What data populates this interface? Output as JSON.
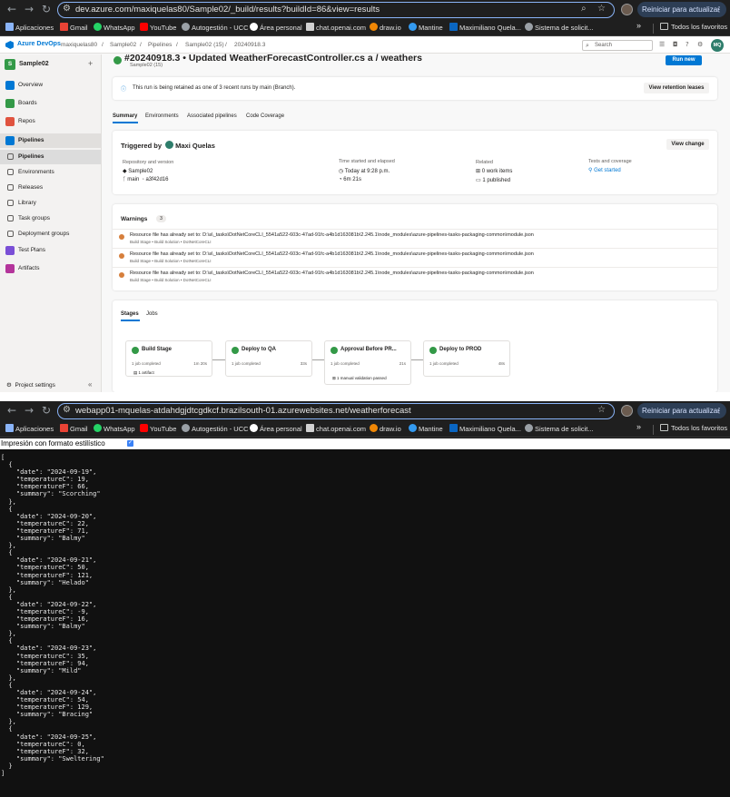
{
  "browser_top": {
    "url": "dev.azure.com/maxiquelas80/Sample02/_build/results?buildId=86&view=results",
    "restart_label": "Reiniciar para actualizar",
    "bookmarks": [
      "Aplicaciones",
      "Gmail",
      "WhatsApp",
      "YouTube",
      "Autogestión - UCC",
      "Área personal",
      "chat.openai.com",
      "draw.io",
      "Mantine",
      "Maximiliano Quela...",
      "Sistema de solicit..."
    ],
    "all_bookmarks": "Todos los favoritos"
  },
  "ado": {
    "brand": "Azure DevOps",
    "breadcrumbs": [
      "maxiquelas80",
      "/",
      "Sample02",
      "/",
      "Pipelines",
      "/",
      "Sample02 (15)",
      "/",
      "20240918.3"
    ],
    "search_placeholder": "Search",
    "avatar_initials": "MQ",
    "project_initial": "S",
    "project_name": "Sample02",
    "nav": [
      "Overview",
      "Boards",
      "Repos",
      "Pipelines",
      "Pipelines",
      "Environments",
      "Releases",
      "Library",
      "Task groups",
      "Deployment groups",
      "Test Plans",
      "Artifacts"
    ],
    "project_settings": "Project settings",
    "run_title": "#20240918.3 • Updated WeatherForecastController.cs a / weathers",
    "run_sub": "Sample02 (15)",
    "run_new": "Run new",
    "retention_text": "This run is being retained as one of 3 recent runs by main (Branch).",
    "retention_button": "View retention leases",
    "tabs": [
      "Summary",
      "Environments",
      "Associated pipelines",
      "Code Coverage"
    ],
    "triggered_by": "Triggered by",
    "triggered_user": "Maxi Quelas",
    "view_change": "View change",
    "summary": {
      "repo_label": "Repository and version",
      "repo": "Sample02",
      "branch": "main",
      "commit": "a3f42d16",
      "time_label": "Time started and elapsed",
      "time": "Today at 9:28 p.m.",
      "elapsed": "6m 21s",
      "related_label": "Related",
      "work_items": "0 work items",
      "published": "1 published",
      "tests_label": "Tests and coverage",
      "get_started": "Get started"
    },
    "warnings_title": "Warnings",
    "warnings_count": "3",
    "warnings": [
      {
        "msg": "Resource file has already set to: D:\\a\\_tasks\\DotNetCoreCLI_5541a522-603c-47ad-91fc-a4b1d163081b\\2.245.1\\node_modules\\azure-pipelines-tasks-packaging-common\\module.json",
        "sub": "Build Stage • Build Solution • DotNetCoreCLI"
      },
      {
        "msg": "Resource file has already set to: D:\\a\\_tasks\\DotNetCoreCLI_5541a522-603c-47ad-91fc-a4b1d163081b\\2.245.1\\node_modules\\azure-pipelines-tasks-packaging-common\\module.json",
        "sub": "Build Stage • Build Solution • DotNetCoreCLI"
      },
      {
        "msg": "Resource file has already set to: D:\\a\\_tasks\\DotNetCoreCLI_5541a522-603c-47ad-91fc-a4b1d163081b\\2.245.1\\node_modules\\azure-pipelines-tasks-packaging-common\\module.json",
        "sub": "Build Stage • Build Solution • DotNetCoreCLI"
      }
    ],
    "stages_tabs": [
      "Stages",
      "Jobs"
    ],
    "stages": [
      {
        "name": "Build Stage",
        "jobs": "1 job completed",
        "duration": "1m 20s",
        "extra": "1 artifact"
      },
      {
        "name": "Deploy to QA",
        "jobs": "1 job completed",
        "duration": "33s",
        "extra": ""
      },
      {
        "name": "Approval Before PR...",
        "jobs": "1 job completed",
        "duration": "21s",
        "extra": "1 manual validation passed"
      },
      {
        "name": "Deploy to PROD",
        "jobs": "1 job completed",
        "duration": "48s",
        "extra": ""
      }
    ],
    "colors": {
      "brand_blue": "#0078d4",
      "success_green": "#339947",
      "warning_orange": "#d67f3c"
    }
  },
  "browser_bottom": {
    "url": "webapp01-mquelas-atdahdgjdtcgdkcf.brazilsouth-01.azurewebsites.net/weatherforecast",
    "restart_label": "Reiniciar para actualizar",
    "pretty_print_label": "Impresión con formato estilístico",
    "json_text": "[\n  {\n    \"date\": \"2024-09-19\",\n    \"temperatureC\": 19,\n    \"temperatureF\": 66,\n    \"summary\": \"Scorching\"\n  },\n  {\n    \"date\": \"2024-09-20\",\n    \"temperatureC\": 22,\n    \"temperatureF\": 71,\n    \"summary\": \"Balmy\"\n  },\n  {\n    \"date\": \"2024-09-21\",\n    \"temperatureC\": 50,\n    \"temperatureF\": 121,\n    \"summary\": \"Helado\"\n  },\n  {\n    \"date\": \"2024-09-22\",\n    \"temperatureC\": -9,\n    \"temperatureF\": 16,\n    \"summary\": \"Balmy\"\n  },\n  {\n    \"date\": \"2024-09-23\",\n    \"temperatureC\": 35,\n    \"temperatureF\": 94,\n    \"summary\": \"Mild\"\n  },\n  {\n    \"date\": \"2024-09-24\",\n    \"temperatureC\": 54,\n    \"temperatureF\": 129,\n    \"summary\": \"Bracing\"\n  },\n  {\n    \"date\": \"2024-09-25\",\n    \"temperatureC\": 0,\n    \"temperatureF\": 32,\n    \"summary\": \"Sweltering\"\n  }\n]"
  }
}
